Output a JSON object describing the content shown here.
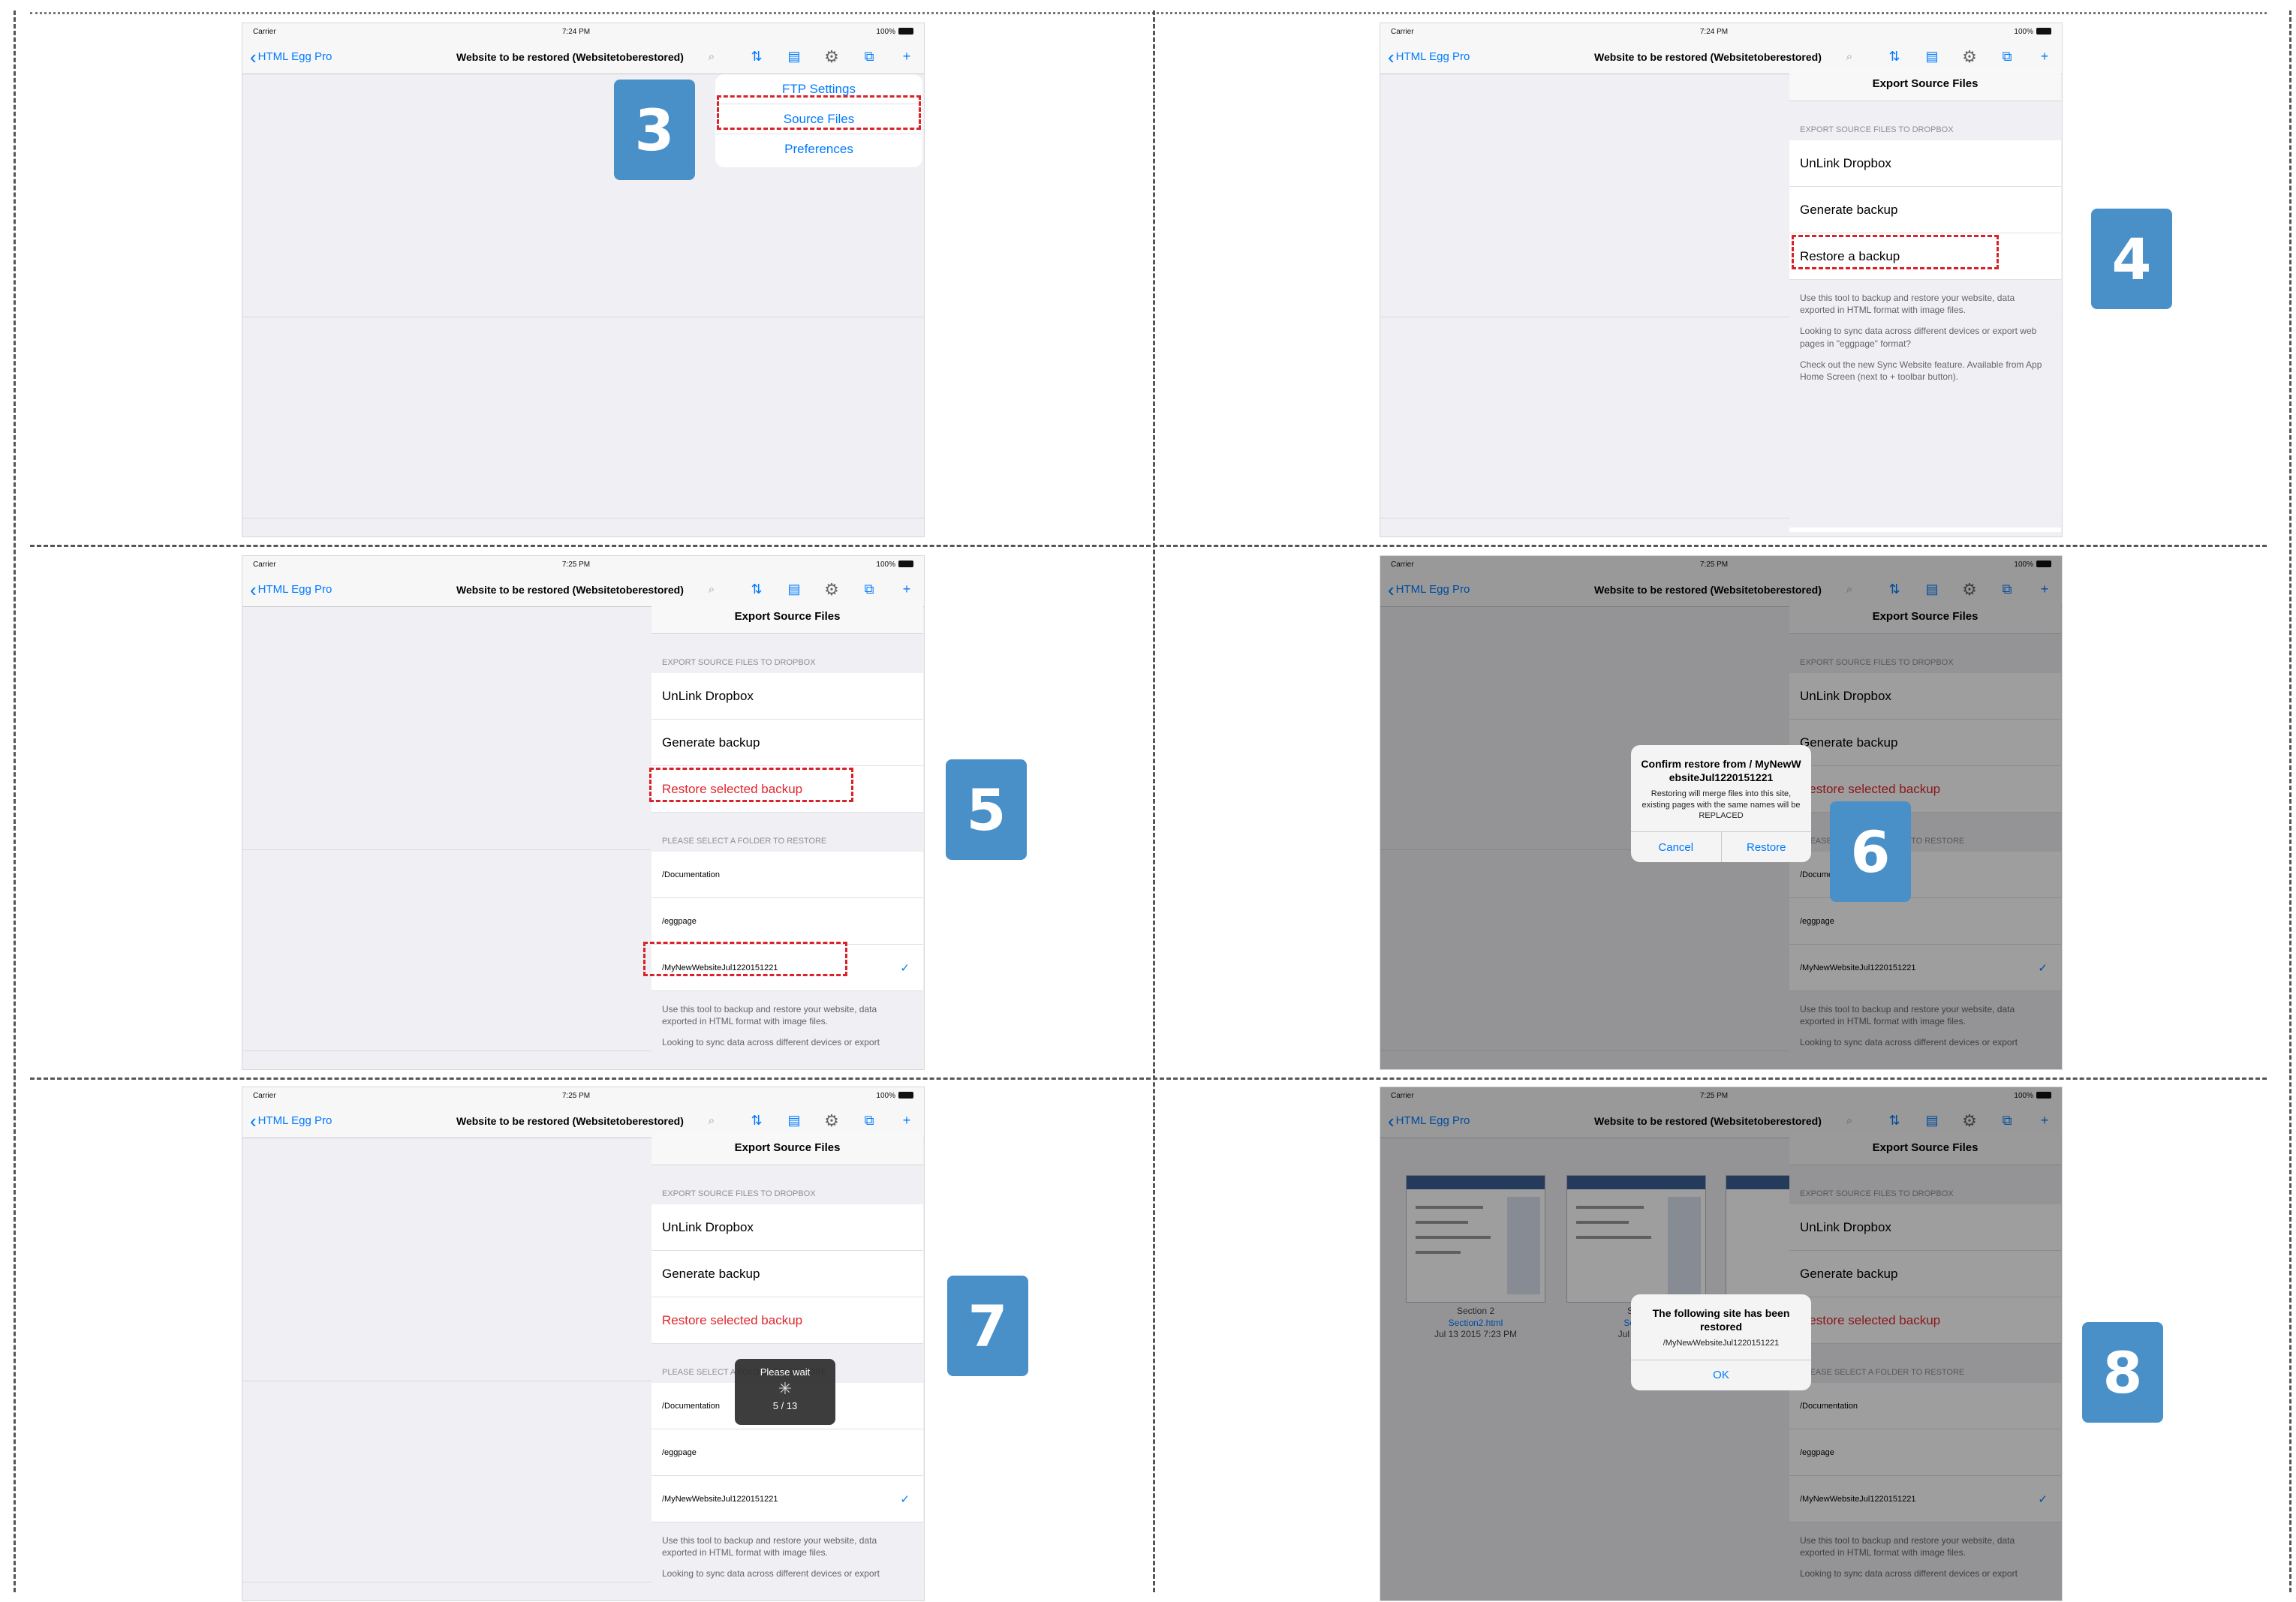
{
  "device": {
    "carrier": "Carrier",
    "times": [
      "7:24 PM",
      "7:24 PM",
      "7:25 PM",
      "7:25 PM",
      "7:25 PM",
      "7:25 PM"
    ],
    "battery": "100%"
  },
  "nav": {
    "back_label": "HTML Egg Pro",
    "title": "Website to be restored (Websitetoberestored)"
  },
  "icons": {
    "search": "search-icon",
    "sync": "sync-icon",
    "page": "page-icon",
    "gear": "gear-icon",
    "export": "export-icon",
    "add": "plus-icon"
  },
  "menu": {
    "items": [
      "FTP Settings",
      "Source Files",
      "Preferences"
    ]
  },
  "export": {
    "title": "Export Source Files",
    "section_dropbox": "EXPORT SOURCE FILES TO DROPBOX",
    "unlink": "UnLink Dropbox",
    "generate": "Generate backup",
    "restore": "Restore a backup",
    "restore_selected": "Restore selected backup",
    "section_folder": "PLEASE SELECT A FOLDER TO RESTORE",
    "folders": [
      "/Documentation",
      "/eggpage",
      "/MyNewWebsiteJul1220151221"
    ],
    "footer": [
      "Use this tool to backup and restore your website, data exported in HTML format with image files.",
      "Looking to sync data across different devices or export web pages in \"eggpage\" format?",
      "Check out the new Sync Website feature. Available from App Home Screen (next to + toolbar button)."
    ],
    "footer_cut": "Looking to sync data across different devices or export"
  },
  "confirm": {
    "title": "Confirm restore from / MyNewWebsiteJul1220151221",
    "message": "Restoring will merge files into this site, existing pages with the same names will be REPLACED",
    "cancel": "Cancel",
    "restore": "Restore"
  },
  "wait": {
    "label": "Please wait",
    "progress": "5 / 13"
  },
  "done": {
    "title": "The following site has been restored",
    "path": "/MyNewWebsiteJul1220151221",
    "ok": "OK"
  },
  "thumbs": [
    {
      "caption": "Section 2",
      "link": "Section2.html",
      "date": "Jul 13 2015 7:23 PM"
    },
    {
      "caption": "Sect",
      "link": "Sectio",
      "date": "Jul 13 20"
    }
  ],
  "steps": [
    "3",
    "4",
    "5",
    "6",
    "7",
    "8"
  ]
}
